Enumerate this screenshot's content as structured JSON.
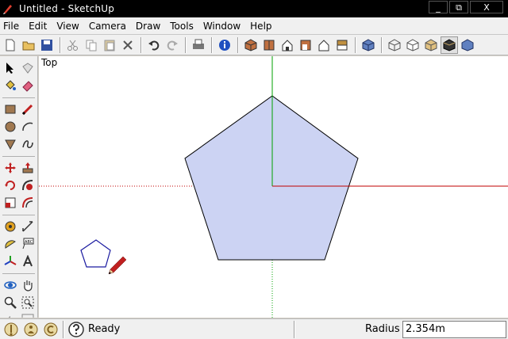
{
  "window": {
    "title": "Untitled - SketchUp",
    "minimize": "_",
    "maximize": "⧉",
    "close": "X"
  },
  "menu": [
    "File",
    "Edit",
    "View",
    "Camera",
    "Draw",
    "Tools",
    "Window",
    "Help"
  ],
  "viewport": {
    "view_name": "Top",
    "fill_color": "#ccd3f3",
    "edge_color": "#000000",
    "axis_green": "#00a000",
    "axis_red": "#c00000"
  },
  "status": {
    "text": "Ready",
    "measure_label": "Radius",
    "measure_value": "2.354m"
  }
}
